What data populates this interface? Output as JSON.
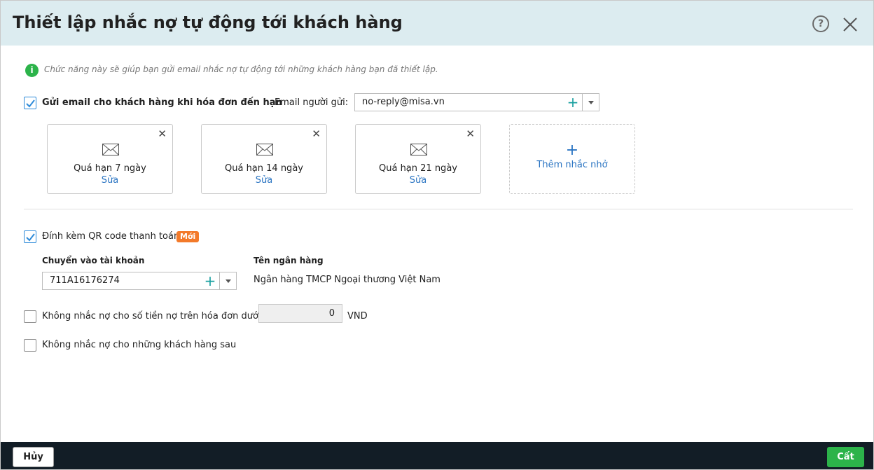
{
  "dialog": {
    "title": "Thiết lập nhắc nợ tự động tới khách hàng",
    "help_icon": "?",
    "info_text": "Chức năng này sẽ giúp bạn gửi email nhắc nợ tự động tới những khách hàng bạn đã thiết lập.",
    "info_icon_glyph": "i"
  },
  "email_section": {
    "send_label": "Gửi email cho khách hàng khi hóa đơn đến hạn",
    "send_checked": true,
    "sender_label": "Email người gửi:",
    "sender_value": "no-reply@misa.vn",
    "reminders": [
      {
        "name": "Quá hạn 7 ngày",
        "edit": "Sửa"
      },
      {
        "name": "Quá hạn 14 ngày",
        "edit": "Sửa"
      },
      {
        "name": "Quá hạn 21 ngày",
        "edit": "Sửa"
      }
    ],
    "remove_glyph": "✕",
    "add_glyph": "+",
    "add_label": "Thêm nhắc nhở"
  },
  "qr_section": {
    "attach_label": "Đính kèm QR code thanh toán",
    "attach_checked": true,
    "new_badge": "Mới",
    "account_label": "Chuyển vào tài khoản",
    "account_value": "711A16176274",
    "bank_label": "Tên ngân hàng",
    "bank_value": "Ngân hàng TMCP Ngoại thương Việt Nam"
  },
  "options": {
    "min_amount_label": "Không nhắc nợ cho số tiền nợ trên hóa đơn dưới",
    "min_amount_value": "0",
    "currency": "VND",
    "exclude_label": "Không nhắc nợ cho những khách hàng sau"
  },
  "footer": {
    "cancel_label": "Hủy",
    "save_label": "Cất"
  },
  "colors": {
    "header_bg": "#dcecf0",
    "accent_green": "#2cb34a",
    "link_blue": "#2a74c2",
    "badge_orange": "#f37a2a",
    "footer_bg": "#121d26"
  }
}
